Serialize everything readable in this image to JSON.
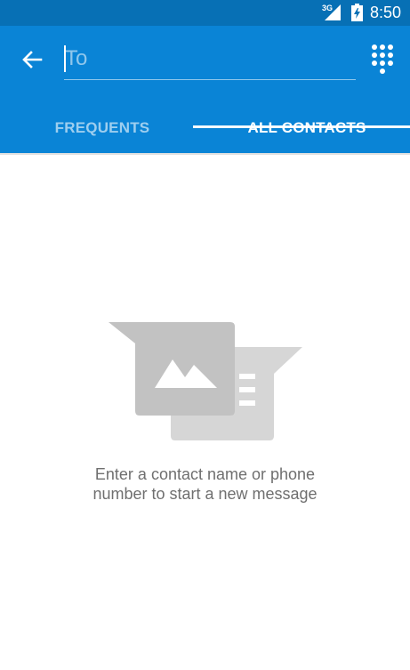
{
  "status_bar": {
    "time": "8:50",
    "network_label": "3G",
    "icons": [
      "signal-icon",
      "battery-charging-icon"
    ]
  },
  "app_bar": {
    "back_icon": "arrow-left-icon",
    "to_placeholder": "To",
    "to_value": "",
    "dialpad_icon": "dialpad-icon",
    "colors": {
      "app_bar": "#0a84d6",
      "status_bar": "#0770b5"
    }
  },
  "tabs": [
    {
      "label": "FREQUENTS",
      "selected": false
    },
    {
      "label": "ALL CONTACTS",
      "selected": true
    }
  ],
  "empty_state": {
    "icon": "new-message-illustration-icon",
    "message_line1": "Enter a contact name or phone",
    "message_line2": "number to start a new message"
  }
}
